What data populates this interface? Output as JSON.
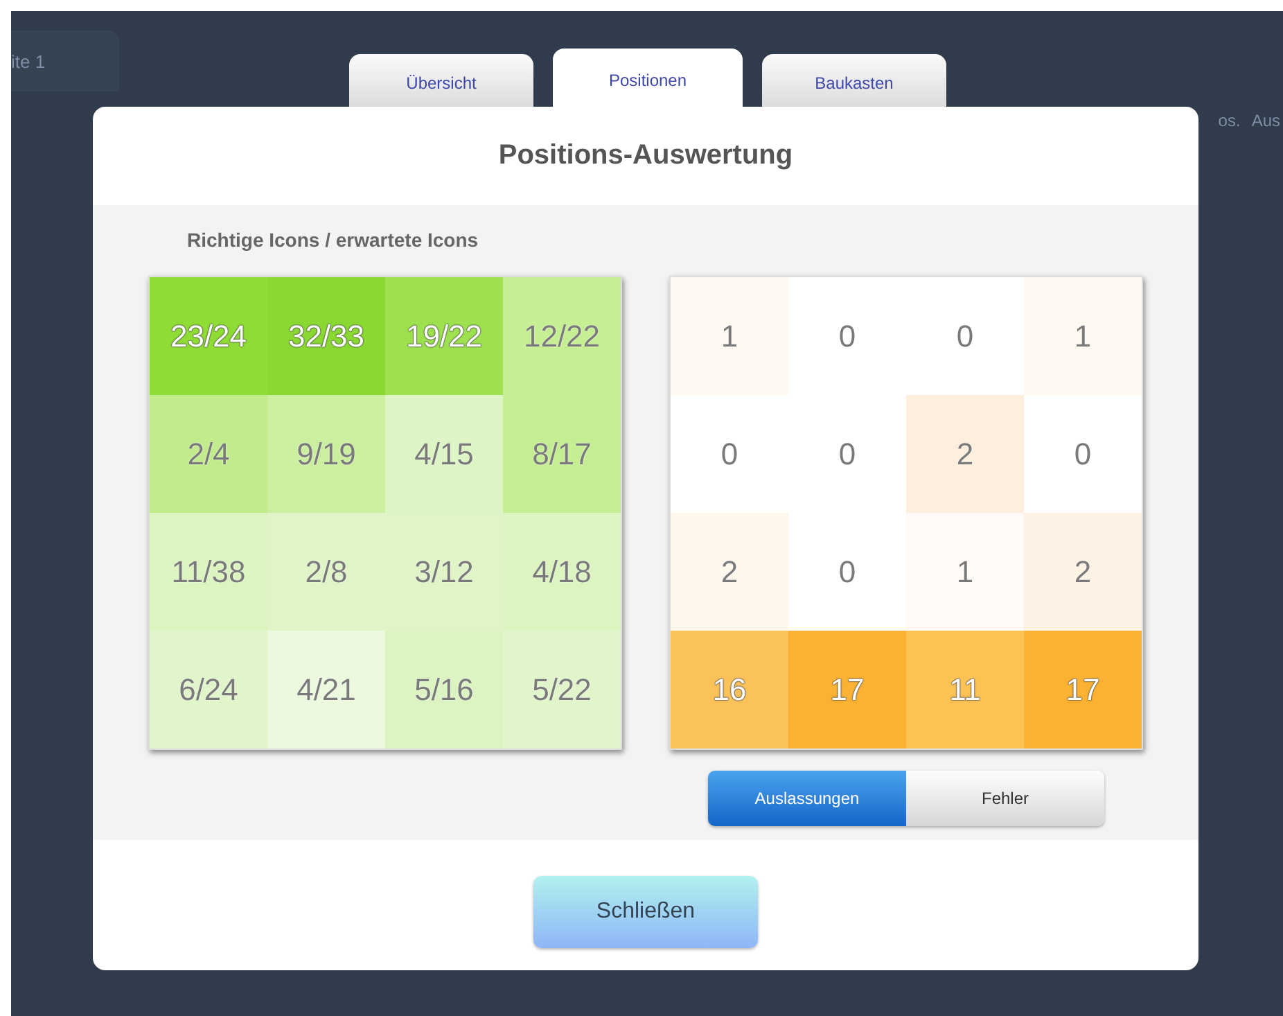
{
  "background": {
    "tab": "ite 1",
    "headers": [
      "os.",
      "Aus"
    ]
  },
  "tabs": [
    {
      "label": "Übersicht",
      "selected": false
    },
    {
      "label": "Positionen",
      "selected": true
    },
    {
      "label": "Baukasten",
      "selected": false
    }
  ],
  "dialog": {
    "title": "Positions-Auswertung",
    "left_grid": {
      "caption": "Richtige Icons / erwartete Icons",
      "cells": [
        [
          {
            "text": "23/24",
            "color": "#8fdc35"
          },
          {
            "text": "32/33",
            "color": "#8ad932"
          },
          {
            "text": "19/22",
            "color": "#9ee14e"
          },
          {
            "text": "12/22",
            "color": "#c6ee93"
          }
        ],
        [
          {
            "text": "2/4",
            "color": "#c2ec8c"
          },
          {
            "text": "9/19",
            "color": "#cbef9e"
          },
          {
            "text": "4/15",
            "color": "#ddf5c4"
          },
          {
            "text": "8/17",
            "color": "#c5ed92"
          }
        ],
        [
          {
            "text": "11/38",
            "color": "#dbf4c0"
          },
          {
            "text": "2/8",
            "color": "#dff5c8"
          },
          {
            "text": "3/12",
            "color": "#dff5c8"
          },
          {
            "text": "4/18",
            "color": "#dbf4c0"
          }
        ],
        [
          {
            "text": "6/24",
            "color": "#e1f5cb"
          },
          {
            "text": "4/21",
            "color": "#ecf9df"
          },
          {
            "text": "5/16",
            "color": "#dbf4c2"
          },
          {
            "text": "5/22",
            "color": "#e1f5cb"
          }
        ]
      ]
    },
    "right_grid": {
      "cells": [
        [
          {
            "text": "1",
            "color": "#fff8f0"
          },
          {
            "text": "0",
            "color": "#ffffff"
          },
          {
            "text": "0",
            "color": "#ffffff"
          },
          {
            "text": "1",
            "color": "#fff8f0"
          }
        ],
        [
          {
            "text": "0",
            "color": "#ffffff"
          },
          {
            "text": "0",
            "color": "#ffffff"
          },
          {
            "text": "2",
            "color": "#fdeedd"
          },
          {
            "text": "0",
            "color": "#ffffff"
          }
        ],
        [
          {
            "text": "2",
            "color": "#fff6ec"
          },
          {
            "text": "0",
            "color": "#ffffff"
          },
          {
            "text": "1",
            "color": "#fffaf5"
          },
          {
            "text": "2",
            "color": "#fef2e5"
          }
        ],
        [
          {
            "text": "16",
            "color": "#fcc25a"
          },
          {
            "text": "17",
            "color": "#fbb233"
          },
          {
            "text": "11",
            "color": "#fcc254"
          },
          {
            "text": "17",
            "color": "#fbb233"
          }
        ]
      ]
    },
    "toggle": [
      {
        "label": "Auslassungen",
        "selected": true
      },
      {
        "label": "Fehler",
        "selected": false
      }
    ],
    "close_button": "Schließen"
  }
}
